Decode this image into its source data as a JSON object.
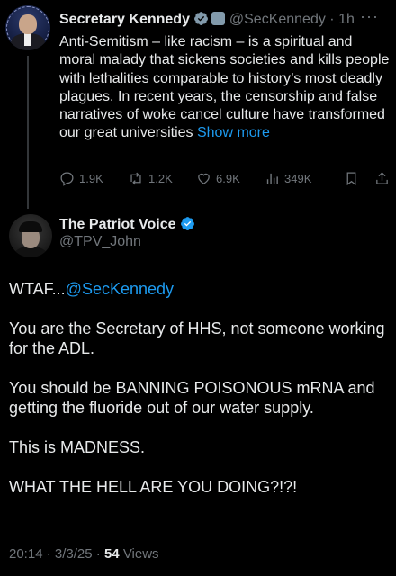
{
  "tweet1": {
    "name": "Secretary Kennedy",
    "handle": "@SecKennedy",
    "time": "1h",
    "more": "···",
    "text": "Anti-Semitism – like racism – is a spiritual and moral malady that sickens societies and kills people with lethalities comparable to history’s most deadly plagues. In recent years, the censorship and false narratives of woke cancel culture have transformed our great universities",
    "show_more": "Show more",
    "actions": {
      "reply": "1.9K",
      "repost": "1.2K",
      "like": "6.9K",
      "views": "349K"
    },
    "icons": [
      "verified-badge-icon",
      "government-badge-icon",
      "reply-icon",
      "repost-icon",
      "like-icon",
      "views-icon",
      "bookmark-icon",
      "share-icon"
    ]
  },
  "tweet2": {
    "name": "The Patriot Voice",
    "handle": "@TPV_John",
    "body": {
      "line1_prefix": "WTAF...",
      "line1_mention": "@SecKennedy",
      "p2": "You are the Secretary of HHS, not someone working for the ADL.",
      "p3": "You should be BANNING POISONOUS mRNA and getting the fluoride out of our water supply.",
      "p4": "This is MADNESS.",
      "p5": "WHAT THE HELL ARE YOU DOING?!?!"
    },
    "time": "20:14",
    "date": "3/3/25",
    "views_count": "54",
    "views_label": "Views"
  },
  "colors": {
    "background": "#000000",
    "text": "#e7e9ea",
    "muted": "#71767b",
    "accent": "#1d9bf0"
  }
}
